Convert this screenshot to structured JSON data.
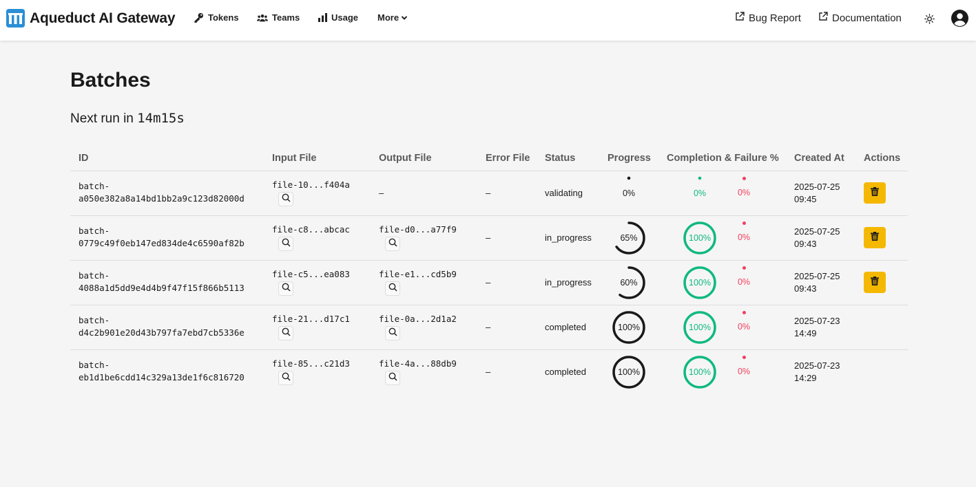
{
  "app": {
    "name": "Aqueduct AI Gateway",
    "logo_icon": "aqueduct-logo-icon",
    "brand_color": "#2a8fd6"
  },
  "nav": {
    "tokens": "Tokens",
    "teams": "Teams",
    "usage": "Usage",
    "more": "More",
    "bug_report": "Bug Report",
    "documentation": "Documentation"
  },
  "page": {
    "title": "Batches",
    "next_run_prefix": "Next run in",
    "next_run_value": "14m15s"
  },
  "table": {
    "headers": {
      "id": "ID",
      "input_file": "Input File",
      "output_file": "Output File",
      "error_file": "Error File",
      "status": "Status",
      "progress": "Progress",
      "completion_failure": "Completion & Failure %",
      "created_at": "Created At",
      "actions": "Actions"
    },
    "rows": [
      {
        "id_line1": "batch-",
        "id_line2": "a050e382a8a14bd1bb2a9c123d82000d",
        "input_file": "file-10...f404a",
        "output_file": "–",
        "error_file": "–",
        "status": "validating",
        "progress": 0,
        "progress_label": "0%",
        "completion": 0,
        "completion_label": "0%",
        "failure": 0,
        "failure_label": "0%",
        "created_date": "2025-07-25",
        "created_time": "09:45"
      },
      {
        "id_line1": "batch-",
        "id_line2": "0779c49f0eb147ed834de4c6590af82b",
        "input_file": "file-c8...abcac",
        "output_file": "file-d0...a77f9",
        "error_file": "–",
        "status": "in_progress",
        "progress": 65,
        "progress_label": "65%",
        "completion": 100,
        "completion_label": "100%",
        "failure": 0,
        "failure_label": "0%",
        "created_date": "2025-07-25",
        "created_time": "09:43"
      },
      {
        "id_line1": "batch-",
        "id_line2": "4088a1d5dd9e4d4b9f47f15f866b5113",
        "input_file": "file-c5...ea083",
        "output_file": "file-e1...cd5b9",
        "error_file": "–",
        "status": "in_progress",
        "progress": 60,
        "progress_label": "60%",
        "completion": 100,
        "completion_label": "100%",
        "failure": 0,
        "failure_label": "0%",
        "created_date": "2025-07-25",
        "created_time": "09:43"
      },
      {
        "id_line1": "batch-",
        "id_line2": "d4c2b901e20d43b797fa7ebd7cb5336e",
        "input_file": "file-21...d17c1",
        "output_file": "file-0a...2d1a2",
        "error_file": "–",
        "status": "completed",
        "progress": 100,
        "progress_label": "100%",
        "completion": 100,
        "completion_label": "100%",
        "failure": 0,
        "failure_label": "0%",
        "created_date": "2025-07-23",
        "created_time": "14:49"
      },
      {
        "id_line1": "batch-",
        "id_line2": "eb1d1be6cdd14c329a13de1f6c816720",
        "input_file": "file-85...c21d3",
        "output_file": "file-4a...88db9",
        "error_file": "–",
        "status": "completed",
        "progress": 100,
        "progress_label": "100%",
        "completion": 100,
        "completion_label": "100%",
        "failure": 0,
        "failure_label": "0%",
        "created_date": "2025-07-23",
        "created_time": "14:29"
      }
    ]
  },
  "colors": {
    "completion": "#10b981",
    "failure": "#f43f5e",
    "progress": "#1a1a1a",
    "delete": "#f5b800"
  },
  "icons": [
    "key-icon",
    "users-icon",
    "bar-chart-icon",
    "chevron-down-icon",
    "external-link-icon",
    "sun-icon",
    "user-circle-icon",
    "search-icon",
    "trash-icon"
  ]
}
